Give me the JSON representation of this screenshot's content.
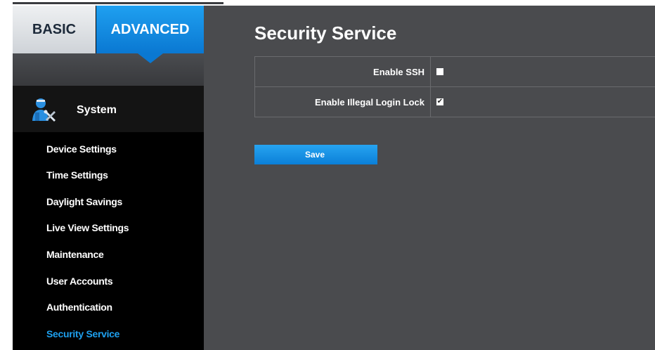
{
  "tabs": {
    "basic": "BASIC",
    "advanced": "ADVANCED"
  },
  "sidebar": {
    "section_label": "System",
    "section_icon": "technician-tools-icon",
    "items": [
      {
        "label": "Device Settings",
        "active": false
      },
      {
        "label": "Time Settings",
        "active": false
      },
      {
        "label": "Daylight Savings",
        "active": false
      },
      {
        "label": "Live View Settings",
        "active": false
      },
      {
        "label": "Maintenance",
        "active": false
      },
      {
        "label": "User Accounts",
        "active": false
      },
      {
        "label": "Authentication",
        "active": false
      },
      {
        "label": "Security Service",
        "active": true
      }
    ]
  },
  "main": {
    "title": "Security Service",
    "settings": [
      {
        "label": "Enable SSH",
        "checked": false
      },
      {
        "label": "Enable Illegal Login Lock",
        "checked": true
      }
    ],
    "save_label": "Save"
  },
  "colors": {
    "accent": "#1ea0ee",
    "panel_bg": "#4a4b4e",
    "sidebar_bg": "#000000"
  }
}
